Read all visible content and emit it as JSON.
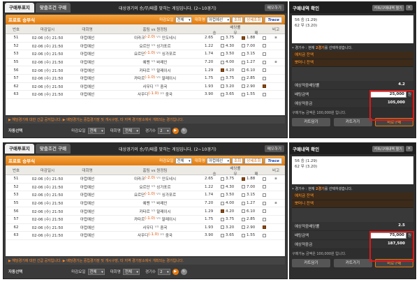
{
  "tabs": {
    "active": "구매투표지",
    "inactive": "맞춤조건 구매"
  },
  "notice": "대상경기의 승/무/패를 맞히는 게임입니다. (2~10경기)",
  "close_label": "메모하기",
  "filter": {
    "title": "프로토 승부식",
    "deadline_label": "마감요일",
    "deadline_value": "전체",
    "league_label": "대회명",
    "league_value": "아컵예선",
    "search_label": "조회",
    "detail_label": "상세조회",
    "logo": "Trace"
  },
  "table": {
    "headers": [
      "번호",
      "마감일시",
      "대회명",
      "홈팀 vs 원정팀",
      "배당률",
      "비고"
    ],
    "odds_headers": [
      "승",
      "무",
      "패"
    ],
    "rows": [
      {
        "no": "51",
        "date": "02-06 (수) 21:50",
        "league": "아컵예선",
        "home": "이라크",
        "hc": "(-2.0)",
        "away": "인도네시",
        "w": "2.65",
        "d": "3.75",
        "l": "1.88"
      },
      {
        "no": "52",
        "date": "02-06 (수) 21:50",
        "league": "아컵예선",
        "home": "요르단",
        "hc": "",
        "away": "싱가포르",
        "w": "1.22",
        "d": "4.30",
        "l": "7.00"
      },
      {
        "no": "53",
        "date": "02-06 (수) 21:50",
        "league": "아컵예선",
        "home": "요르단",
        "hc": "(-1.0)",
        "away": "싱가포르",
        "w": "1.74",
        "d": "3.50",
        "l": "3.15"
      },
      {
        "no": "55",
        "date": "02-06 (수) 21:50",
        "league": "아컵예선",
        "home": "예멘",
        "hc": "",
        "away": "바레인",
        "w": "7.20",
        "d": "4.00",
        "l": "1.27"
      },
      {
        "no": "56",
        "date": "02-06 (수) 21:50",
        "league": "아컵예선",
        "home": "카타르",
        "hc": "",
        "away": "말레이시",
        "w": "1.29",
        "d": "4.20",
        "l": "6.10"
      },
      {
        "no": "57",
        "date": "02-06 (수) 21:50",
        "league": "아컵예선",
        "home": "카타르",
        "hc": "(-1.0)",
        "away": "말레이시",
        "w": "1.75",
        "d": "3.75",
        "l": "2.85"
      },
      {
        "no": "62",
        "date": "02-06 (수) 21:50",
        "league": "아컵예선",
        "home": "사우디",
        "hc": "",
        "away": "중국",
        "w": "1.93",
        "d": "3.20",
        "l": "2.90"
      },
      {
        "no": "63",
        "date": "02-06 (수) 21:50",
        "league": "아컵예선",
        "home": "사우디",
        "hc": "(-1.0)",
        "away": "중국",
        "w": "3.90",
        "d": "3.65",
        "l": "1.55"
      }
    ]
  },
  "info_line": "▶ 해당경기에 대한 긴급 공지입니다.   ▶ 배당경기는 중립경기장 및 개시구장, 타 지역 경기장소에서 개최되는 경기입니다.",
  "bottom": {
    "auto_label": "자동선택",
    "deadline_label": "마감요일",
    "deadline_value": "전체",
    "league_label": "대회명",
    "league_value": "전체",
    "count_label": "경기수",
    "count_value": "2"
  },
  "panel_a": {
    "checked": [
      [
        "d"
      ],
      [],
      [],
      [],
      [
        "w"
      ],
      [],
      [
        "l"
      ],
      []
    ],
    "right": {
      "title": "구매내역 확인",
      "btn1": "카트/구매내역 열기",
      "list": [
        "56  승 (1.29)",
        "62  무 (3.20)"
      ],
      "select_text": "경기수 : 현재",
      "select_count": "2경기",
      "select_suffix": "를 선택하셨습니다.",
      "balance1": "예치금 잔액",
      "balance2": "뽀머니 잔액",
      "expected_odds_label": "예상적중배당률",
      "expected_odds": "4.2",
      "bet_label": "배팅금액",
      "bet_value": "25,000",
      "bet_unit": "원",
      "payout_label": "예상적중금",
      "payout_value": "105,000",
      "note": "구매가능 금액은 100,000원 입니다.",
      "btn_cart": "카트담기",
      "btn_cart_view": "카트가기",
      "btn_buy": "바로구매"
    }
  },
  "panel_b": {
    "checked": [
      [
        "d"
      ],
      [],
      [],
      [],
      [
        "w"
      ],
      [],
      [
        "l"
      ],
      []
    ],
    "right": {
      "title": "구매내역 확인",
      "btn1": "카트/구매내역 열기",
      "list": [
        "56  승 (1.29)",
        "62  무 (3.20)"
      ],
      "select_text": "경기수 : 현재",
      "select_count": "2경기",
      "select_suffix": "를 선택하셨습니다.",
      "balance1": "예치금 잔액",
      "balance2": "뽀머니 잔액",
      "expected_odds_label": "예상적중배당률",
      "expected_odds": "2.5",
      "bet_label": "배팅금액",
      "bet_value": "75,000",
      "bet_unit": "원",
      "payout_label": "예상적중금",
      "payout_value": "187,500",
      "note": "구매가능 금액은 100,000원 입니다.",
      "btn_cart": "카트담기",
      "btn_cart_view": "카트가기",
      "btn_buy": "바로구매"
    }
  }
}
